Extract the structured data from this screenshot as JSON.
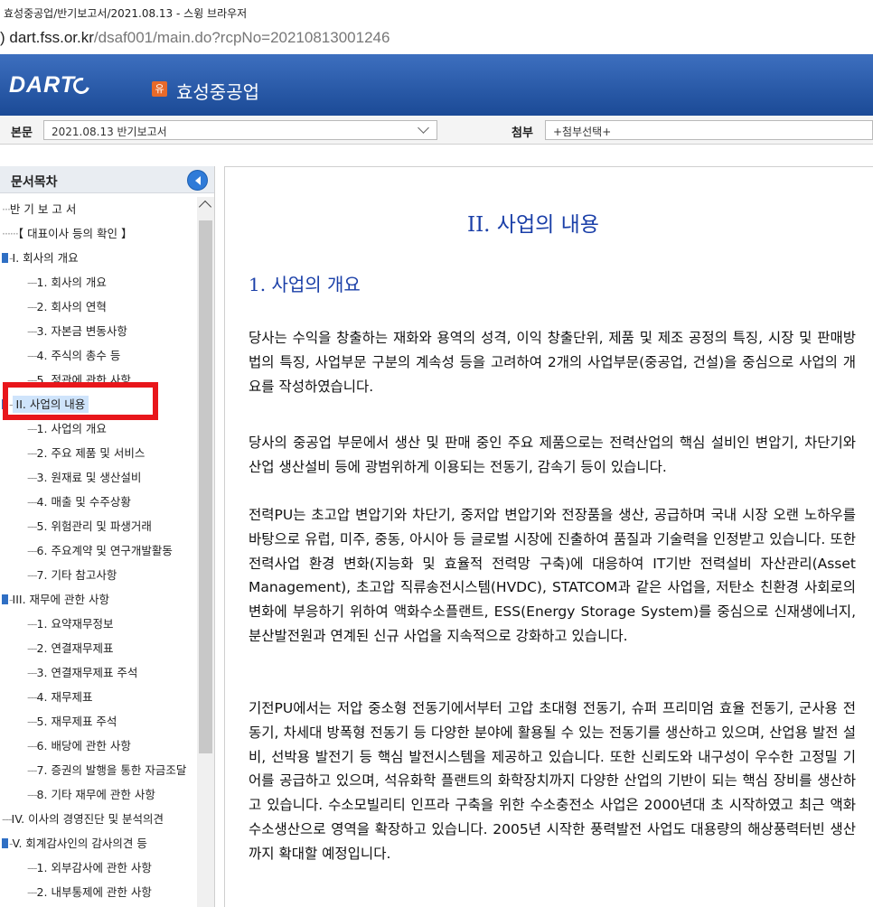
{
  "window": {
    "title": "효성중공업/반기보고서/2021.08.13 - 스윙 브라우저",
    "url_prefix": ") ",
    "url_host": "dart.fss.or.kr",
    "url_path": "/dsaf001/main.do?rcpNo=20210813001246"
  },
  "header": {
    "logo": "DART",
    "badge": "유",
    "company": "효성중공업"
  },
  "selector": {
    "report_label": "본문",
    "report_value": "2021.08.13  반기보고서",
    "attach_label": "첨부",
    "attach_value": "+첨부선택+"
  },
  "toc": {
    "title": "문서목차",
    "items": [
      {
        "text": "반 기 보 고 서",
        "level": 0,
        "prefix": "···"
      },
      {
        "text": "【 대표이사 등의 확인 】",
        "level": 0,
        "prefix": "······"
      },
      {
        "text": "I. 회사의 개요",
        "level": 0,
        "prefix": "-",
        "plus": true
      },
      {
        "text": "1. 회사의 개요",
        "level": 1,
        "prefix": "---"
      },
      {
        "text": "2. 회사의 연혁",
        "level": 1,
        "prefix": "---"
      },
      {
        "text": "3. 자본금 변동사항",
        "level": 1,
        "prefix": "---"
      },
      {
        "text": "4. 주식의 총수 등",
        "level": 1,
        "prefix": "---"
      },
      {
        "text": "5. 정관에 관한 사항",
        "level": 1,
        "prefix": "---"
      },
      {
        "text": "II. 사업의 내용",
        "level": 0,
        "prefix": "-",
        "plus": true,
        "selected": true
      },
      {
        "text": "1. 사업의 개요",
        "level": 1,
        "prefix": "---"
      },
      {
        "text": "2. 주요 제품 및 서비스",
        "level": 1,
        "prefix": "---"
      },
      {
        "text": "3. 원재료 및 생산설비",
        "level": 1,
        "prefix": "---"
      },
      {
        "text": "4. 매출 및 수주상황",
        "level": 1,
        "prefix": "---"
      },
      {
        "text": "5. 위험관리 및 파생거래",
        "level": 1,
        "prefix": "---"
      },
      {
        "text": "6. 주요계약 및 연구개발활동",
        "level": 1,
        "prefix": "---"
      },
      {
        "text": "7. 기타 참고사항",
        "level": 1,
        "prefix": "---"
      },
      {
        "text": "III. 재무에 관한 사항",
        "level": 0,
        "prefix": "-",
        "plus": true
      },
      {
        "text": "1. 요약재무정보",
        "level": 1,
        "prefix": "---"
      },
      {
        "text": "2. 연결재무제표",
        "level": 1,
        "prefix": "---"
      },
      {
        "text": "3. 연결재무제표 주석",
        "level": 1,
        "prefix": "---"
      },
      {
        "text": "4. 재무제표",
        "level": 1,
        "prefix": "---"
      },
      {
        "text": "5. 재무제표 주석",
        "level": 1,
        "prefix": "---"
      },
      {
        "text": "6. 배당에 관한 사항",
        "level": 1,
        "prefix": "---"
      },
      {
        "text": "7. 증권의 발행을 통한 자금조달",
        "level": 1,
        "prefix": "---"
      },
      {
        "text": "8. 기타 재무에 관한 사항",
        "level": 1,
        "prefix": "---"
      },
      {
        "text": "IV. 이사의 경영진단 및 분석의견",
        "level": 0,
        "prefix": "---"
      },
      {
        "text": "V. 회계감사인의 감사의견 등",
        "level": 0,
        "prefix": "-",
        "plus": true
      },
      {
        "text": "1. 외부감사에 관한 사항",
        "level": 1,
        "prefix": "---"
      },
      {
        "text": "2. 내부통제에 관한 사항",
        "level": 1,
        "prefix": "---"
      }
    ]
  },
  "content": {
    "title": "II. 사업의 내용",
    "section": "1. 사업의 개요",
    "paragraphs": [
      "당사는 수익을 창출하는 재화와 용역의 성격, 이익 창출단위, 제품 및 제조 공정의 특징, 시장 및 판매방법의 특징, 사업부문 구분의 계속성 등을 고려하여 2개의 사업부문(중공업, 건설)을 중심으로 사업의 개요를 작성하였습니다.",
      "당사의 중공업 부문에서 생산 및 판매 중인 주요 제품으로는 전력산업의 핵심 설비인 변압기, 차단기와 산업 생산설비 등에 광범위하게 이용되는 전동기, 감속기 등이 있습니다.",
      "전력PU는 초고압 변압기와 차단기, 중저압 변압기와 전장품을 생산, 공급하며 국내 시장 오랜 노하우를 바탕으로 유럽, 미주, 중동, 아시아 등 글로벌 시장에 진출하여 품질과 기술력을 인정받고 있습니다. 또한 전력사업 환경 변화(지능화 및 효율적 전력망 구축)에 대응하여 IT기반 전력설비 자산관리(Asset Management), 초고압 직류송전시스템(HVDC), STATCOM과 같은 사업을, 저탄소 친환경 사회로의 변화에 부응하기 위하여 액화수소플랜트, ESS(Energy Storage System)를 중심으로 신재생에너지, 분산발전원과 연계된 신규 사업을 지속적으로 강화하고 있습니다.",
      "기전PU에서는 저압 중소형 전동기에서부터 고압 초대형 전동기, 슈퍼 프리미엄 효율 전동기, 군사용 전동기, 차세대 방폭형 전동기 등 다양한 분야에 활용될 수 있는 전동기를 생산하고 있으며, 산업용 발전 설비, 선박용 발전기 등 핵심 발전시스템을 제공하고 있습니다. 또한 신뢰도와 내구성이 우수한 고정밀 기어를 공급하고 있으며, 석유화학 플랜트의 화학장치까지 다양한 산업의 기반이 되는 핵심 장비를 생산하고 있습니다. 수소모빌리티 인프라 구축을 위한 수소충전소 사업은 2000년대 초 시작하였고 최근 액화수소생산으로 영역을 확장하고 있습니다. 2005년 시작한 풍력발전 사업도 대용량의 해상풍력터빈 생산까지 확대할 예정입니다."
    ]
  },
  "colors": {
    "header_blue": "#1b4a96",
    "heading_blue": "#1a3fa8",
    "badge_orange": "#e86a2a",
    "highlight_red": "#e8161b",
    "selected_bg": "#cfe4fb"
  }
}
